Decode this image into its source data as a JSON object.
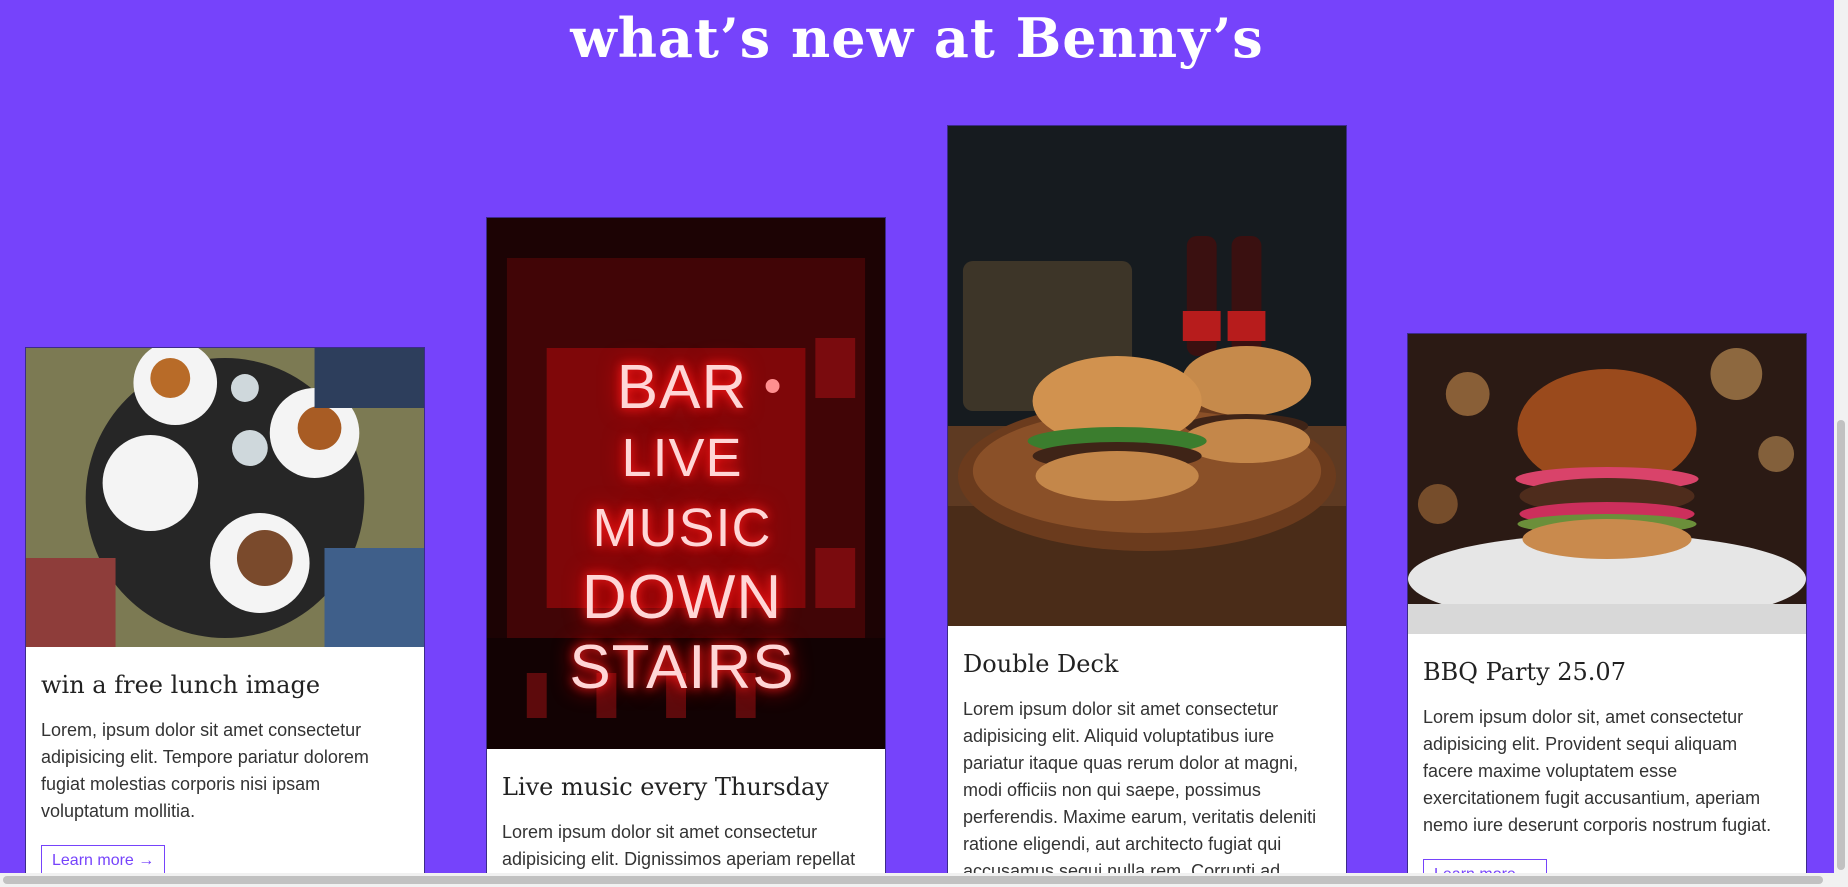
{
  "header": {
    "title": "what’s new at Benny’s"
  },
  "cards": [
    {
      "image_icon": "diners-table-photo",
      "title": "win a free lunch image",
      "text": "Lorem, ipsum dolor sit amet consectetur adipisicing elit. Tempore pariatur dolorem fugiat molestias corporis nisi ipsam voluptatum mollitia.",
      "button": "Learn more →"
    },
    {
      "image_icon": "neon-sign-photo",
      "neon_lines": [
        "BAR",
        "LIVE MUSIC",
        "DOWN",
        "STAIRS"
      ],
      "title": "Live music every Thursday",
      "text": "Lorem ipsum dolor sit amet consectetur adipisicing elit. Dignissimos aperiam repellat",
      "button": ""
    },
    {
      "image_icon": "double-burger-photo",
      "title": "Double Deck",
      "text": "Lorem ipsum dolor sit amet consectetur adipisicing elit. Aliquid voluptatibus iure pariatur itaque quas rerum dolor at magni, modi officiis non qui saepe, possimus perferendis. Maxime earum, veritatis deleniti ratione eligendi, aut architecto fugiat qui accusamus sequi nulla rem. Corrupti ad",
      "button": ""
    },
    {
      "image_icon": "burger-plate-photo",
      "title": "BBQ Party 25.07",
      "text": "Lorem ipsum dolor sit, amet consectetur adipisicing elit. Provident sequi aliquam facere maxime voluptatem esse exercitationem fugit accusantium, aperiam nemo iure deserunt corporis nostrum fugiat.",
      "button": "Learn more →"
    }
  ],
  "colors": {
    "background": "#7643fb",
    "card": "#ffffff",
    "accent": "#7643fb"
  }
}
